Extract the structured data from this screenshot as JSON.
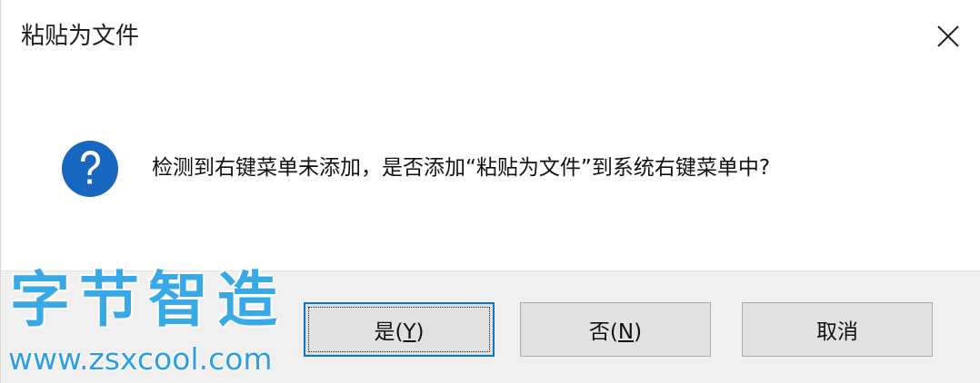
{
  "window": {
    "title": "粘贴为文件",
    "close_icon": "close-icon"
  },
  "message": {
    "icon": "question-icon",
    "icon_color": "#1766c0",
    "text": "检测到右键菜单未添加，是否添加“粘贴为文件”到系统右键菜单中?"
  },
  "buttons": {
    "yes": {
      "label_prefix": "是(",
      "mnemonic": "Y",
      "label_suffix": ")"
    },
    "no": {
      "label_prefix": "否(",
      "mnemonic": "N",
      "label_suffix": ")"
    },
    "cancel": {
      "label": "取消"
    }
  },
  "watermark": {
    "title": "字节智造",
    "url": "www.zsxcool.com",
    "color": "#39a9e6"
  },
  "colors": {
    "footer_bg": "#f0f0f0",
    "button_bg": "#e1e1e1",
    "default_button_border": "#0078d7"
  }
}
